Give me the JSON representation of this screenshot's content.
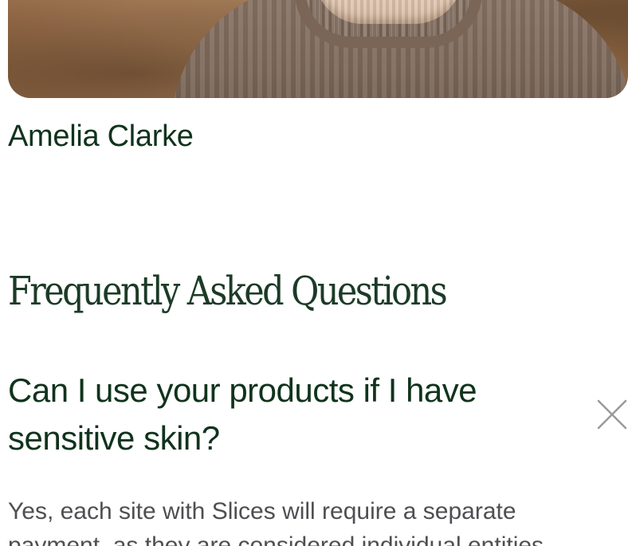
{
  "profile": {
    "name": "Amelia Clarke"
  },
  "faq": {
    "title": "Frequently Asked Questions",
    "items": [
      {
        "question": "Can I use your products if I have sensitive skin?",
        "answer_line_1": "Yes, each site with Slices will require a separate",
        "answer_line_2": "payment, as they are considered individual entities",
        "expanded": true,
        "toggle_icon": "close-icon"
      }
    ]
  },
  "colors": {
    "heading_green": "#10331c",
    "body_gray": "#4d4f52",
    "background": "#ffffff"
  }
}
